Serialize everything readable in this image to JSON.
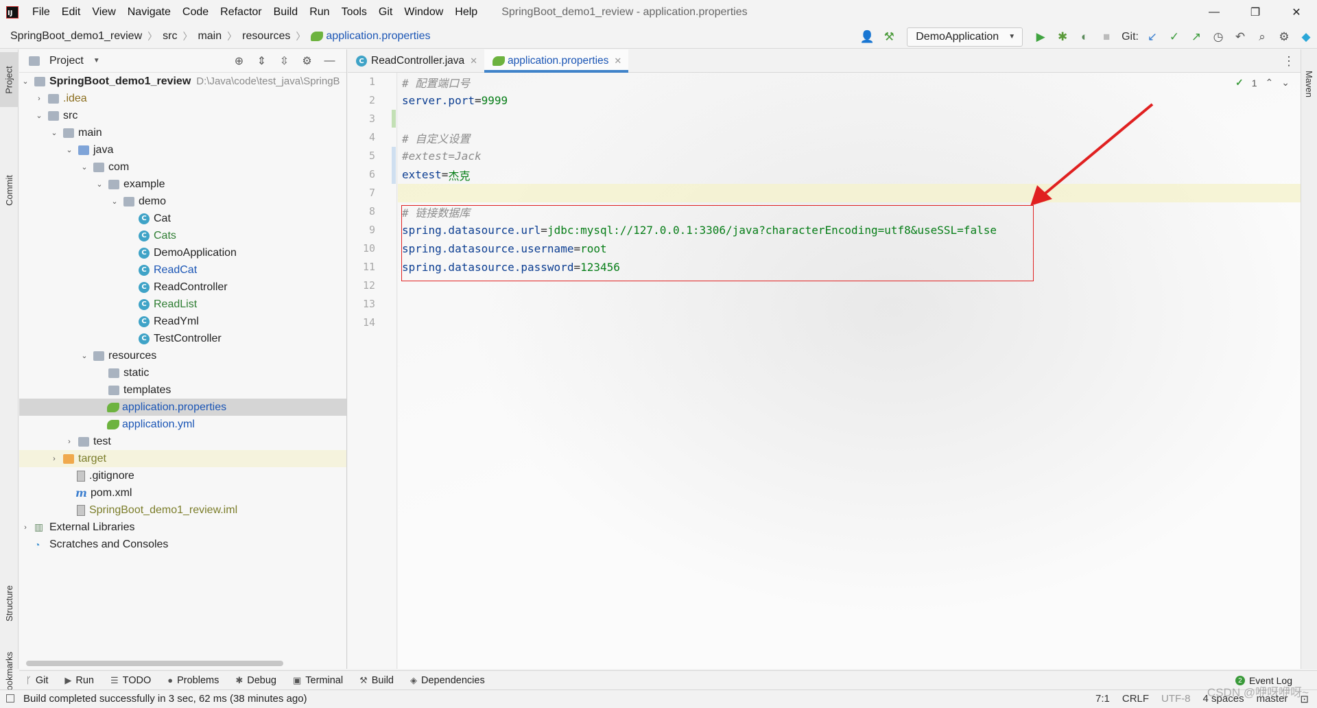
{
  "menubar": {
    "items": [
      "File",
      "Edit",
      "View",
      "Navigate",
      "Code",
      "Refactor",
      "Build",
      "Run",
      "Tools",
      "Git",
      "Window",
      "Help"
    ],
    "window_title": "SpringBoot_demo1_review - application.properties"
  },
  "window_controls": {
    "minimize": "—",
    "restore": "❐",
    "close": "✕"
  },
  "breadcrumb": [
    "SpringBoot_demo1_review",
    "src",
    "main",
    "resources",
    "application.properties"
  ],
  "toolbar": {
    "run_config": "DemoApplication",
    "git_label": "Git:"
  },
  "left_stripe": {
    "project": "Project",
    "commit": "Commit",
    "structure": "Structure",
    "bookmarks": "Bookmarks"
  },
  "right_stripe": {
    "maven": "Maven"
  },
  "project_panel": {
    "title": "Project",
    "root_label": "SpringBoot_demo1_review",
    "root_path": "D:\\Java\\code\\test_java\\SpringB",
    "tree": [
      {
        "label": ".idea"
      },
      {
        "label": "src"
      },
      {
        "label": "main"
      },
      {
        "label": "java"
      },
      {
        "label": "com"
      },
      {
        "label": "example"
      },
      {
        "label": "demo"
      },
      {
        "label": "Cat"
      },
      {
        "label": "Cats"
      },
      {
        "label": "DemoApplication"
      },
      {
        "label": "ReadCat"
      },
      {
        "label": "ReadController"
      },
      {
        "label": "ReadList"
      },
      {
        "label": "ReadYml"
      },
      {
        "label": "TestController"
      },
      {
        "label": "resources"
      },
      {
        "label": "static"
      },
      {
        "label": "templates"
      },
      {
        "label": "application.properties"
      },
      {
        "label": "application.yml"
      },
      {
        "label": "test"
      },
      {
        "label": "target"
      },
      {
        "label": ".gitignore"
      },
      {
        "label": "pom.xml"
      },
      {
        "label": "SpringBoot_demo1_review.iml"
      },
      {
        "label": "External Libraries"
      },
      {
        "label": "Scratches and Consoles"
      }
    ]
  },
  "editor": {
    "tabs": [
      {
        "label": "ReadController.java"
      },
      {
        "label": "application.properties"
      }
    ],
    "inspection_count": "1",
    "line_numbers": [
      "1",
      "2",
      "3",
      "4",
      "5",
      "6",
      "7",
      "8",
      "9",
      "10",
      "11",
      "12",
      "13",
      "14"
    ],
    "lines": {
      "l1_comment": "# 配置端口号",
      "l2_key": "server.port",
      "l2_val": "9999",
      "l4_comment": "# 自定义设置",
      "l5_comment": "#extest=Jack",
      "l6_key": "extest",
      "l6_val": "杰克",
      "l8_comment": "# 链接数据库",
      "l9_key": "spring.datasource.url",
      "l9_val": "jdbc:mysql://127.0.0.1:3306/java?characterEncoding=utf8&useSSL=false",
      "l10_key": "spring.datasource.username",
      "l10_val": "root",
      "l11_key": "spring.datasource.password",
      "l11_val": "123456",
      "equals": "="
    },
    "annotation_color": "#e02020"
  },
  "bottom_tools": [
    "Git",
    "Run",
    "TODO",
    "Problems",
    "Debug",
    "Terminal",
    "Build",
    "Dependencies"
  ],
  "event_log": {
    "label": "Event Log",
    "count": "2"
  },
  "status": {
    "message": "Build completed successfully in 3 sec, 62 ms (38 minutes ago)",
    "position": "7:1",
    "line_sep": "CRLF",
    "encoding": "UTF-8",
    "indent": "4 spaces",
    "branch": "master"
  },
  "watermark": "CSDN @咿呀咿呀~"
}
